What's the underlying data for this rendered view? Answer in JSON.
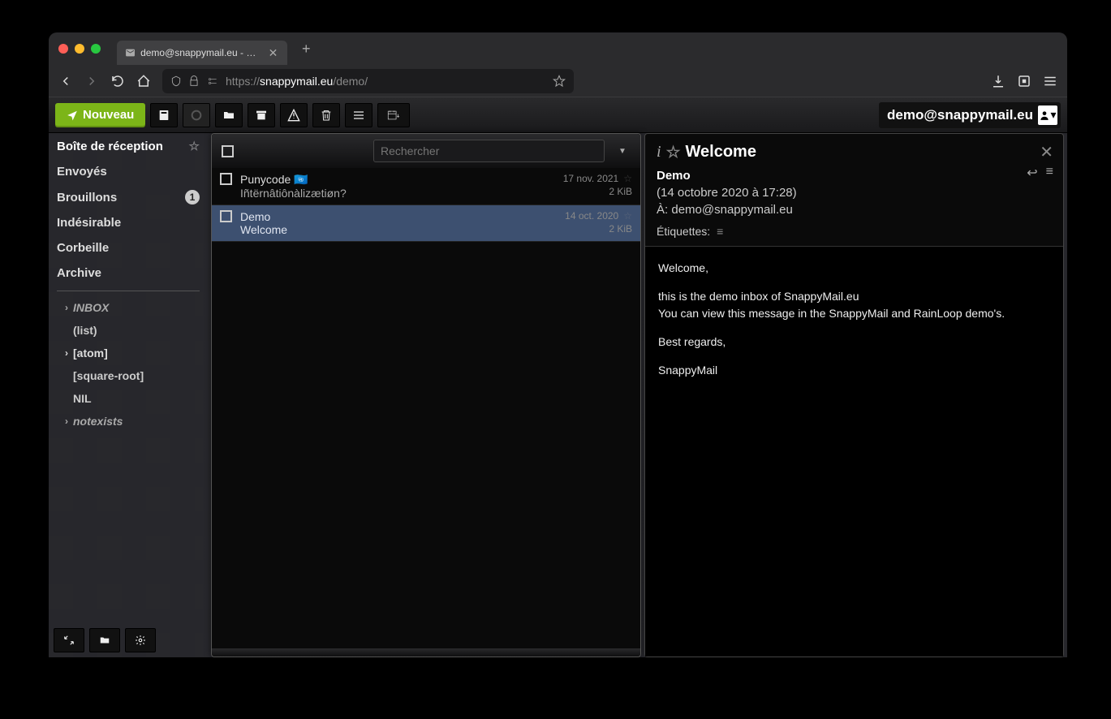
{
  "browser": {
    "tab_title": "demo@snappymail.eu - Boîte m...",
    "url_prefix": "https://",
    "url_domain": "snappymail.eu",
    "url_path": "/demo/"
  },
  "toolbar": {
    "new_label": "Nouveau"
  },
  "account": {
    "email": "demo@snappymail.eu"
  },
  "sidebar": {
    "folders": [
      {
        "label": "Boîte de réception",
        "active": true,
        "star": true
      },
      {
        "label": "Envoyés"
      },
      {
        "label": "Brouillons",
        "badge": "1"
      },
      {
        "label": "Indésirable"
      },
      {
        "label": "Corbeille"
      },
      {
        "label": "Archive"
      }
    ],
    "subfolders": [
      {
        "label": "INBOX",
        "chevron": true,
        "italic": true
      },
      {
        "label": "(list)",
        "plain": true
      },
      {
        "label": "[atom]",
        "chevron": true
      },
      {
        "label": "[square-root]",
        "plain": true
      },
      {
        "label": "NIL",
        "plain": true
      },
      {
        "label": "notexists",
        "chevron": true,
        "italic": true
      }
    ]
  },
  "list": {
    "search_placeholder": "Rechercher",
    "messages": [
      {
        "from": "Punycode 🇺🇳",
        "subject": "Iñtërnâtiônàlizætiøn?",
        "date": "17 nov. 2021",
        "size": "2 KiB",
        "selected": false
      },
      {
        "from": "Demo",
        "subject": "Welcome",
        "date": "14 oct. 2020",
        "size": "2 KiB",
        "selected": true
      }
    ]
  },
  "reader": {
    "subject": "Welcome",
    "from": "Demo",
    "date": "(14 octobre 2020 à 17:28)",
    "to_label": "À:",
    "to": "demo@snappymail.eu",
    "tags_label": "Étiquettes:",
    "body": {
      "p1": "Welcome,",
      "p2": "this is the demo inbox of SnappyMail.eu",
      "p3": "You can view this message in the SnappyMail and RainLoop demo's.",
      "p4": "Best regards,",
      "p5": "SnappyMail"
    }
  }
}
